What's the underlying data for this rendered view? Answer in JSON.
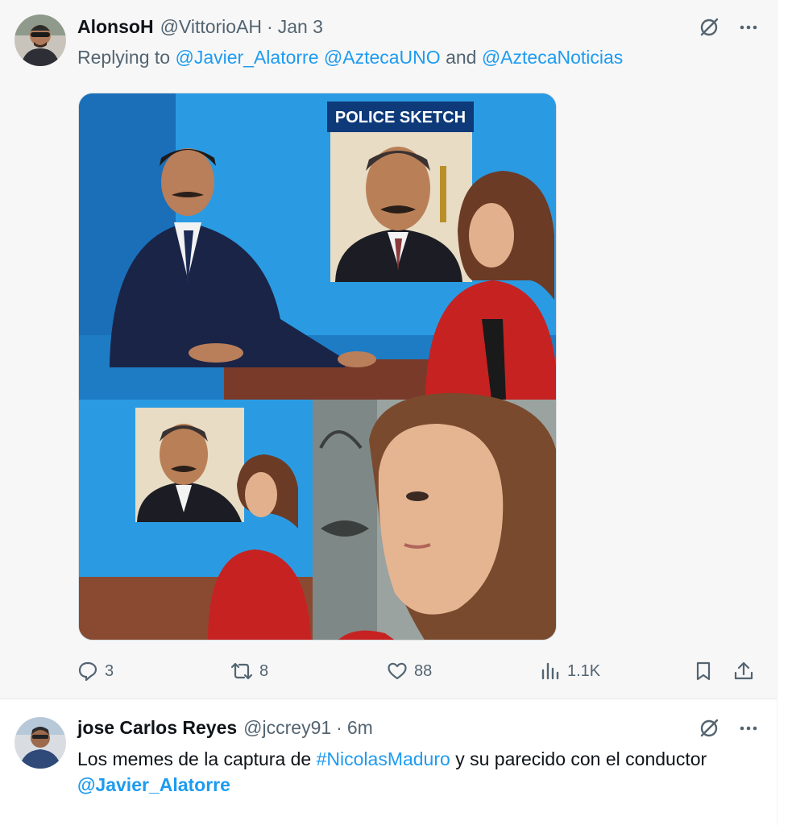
{
  "tweets": [
    {
      "name": "AlonsoH",
      "handle": "@VittorioAH",
      "dot": "·",
      "time": "Jan 3",
      "reply_prefix": "Replying to",
      "reply_mentions": [
        "@Javier_Alatorre",
        "@AztecaUNO"
      ],
      "reply_and": "and",
      "reply_last": "@AztecaNoticias",
      "media": {
        "sketch_label": "POLICE SKETCH"
      },
      "actions": {
        "replies": "3",
        "reposts": "8",
        "likes": "88",
        "views": "1.1K"
      }
    },
    {
      "name": "jose Carlos Reyes",
      "handle": "@jccrey91",
      "dot": "·",
      "time": "6m",
      "text_1": "Los memes de la captura de",
      "hashtag": "#NicolasMaduro",
      "text_2": "y su parecido con el conductor",
      "mention": "@Javier_Alatorre"
    }
  ],
  "colors": {
    "accent": "#1d9bf0",
    "secondary_text": "#536471",
    "primary_text": "#0f1419",
    "tweet1_bg": "#f7f7f7"
  },
  "icons": [
    "grok-icon",
    "more-icon",
    "reply-icon",
    "repost-icon",
    "like-icon",
    "views-icon",
    "bookmark-icon",
    "share-icon"
  ]
}
